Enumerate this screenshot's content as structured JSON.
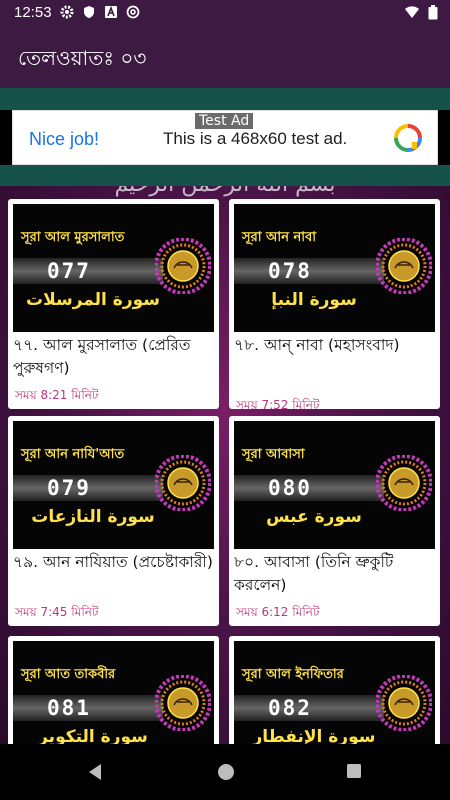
{
  "status_bar": {
    "time": "12:53",
    "icons": [
      "gear-icon",
      "shield-icon",
      "a-badge-icon",
      "at-sign-icon",
      "wifi-icon",
      "battery-icon"
    ]
  },
  "app_bar": {
    "title": "তেলওয়াতঃ ০৩"
  },
  "ad": {
    "label": "Test Ad",
    "nice_job": "Nice job!",
    "text": "This is a 468x60 test ad."
  },
  "content": {
    "arabic_banner": "بسم الله الرحمن الرحيم",
    "cards": [
      {
        "thumb_bengali": "সূরা আল মুরসালাত",
        "thumb_number": "077",
        "thumb_arabic": "سورة المرسلات",
        "title": "৭৭. আল মুরসালাত (প্রেরিত পুরুষগণ)",
        "duration": "সময় 8:21 মিনিট"
      },
      {
        "thumb_bengali": "সূরা আন নাবা",
        "thumb_number": "078",
        "thumb_arabic": "سورة النبإ",
        "title": "৭৮. আন্ নাবা (মহাসংবাদ)",
        "duration": "সময় 7:52 মিনিট"
      },
      {
        "thumb_bengali": "সূরা আন নাযি'আত",
        "thumb_number": "079",
        "thumb_arabic": "سورة النازعات",
        "title": "৭৯. আন নাযিয়াত (প্রচেষ্টাকারী)",
        "duration": "সময় 7:45 মিনিট"
      },
      {
        "thumb_bengali": "সূরা আবাসা",
        "thumb_number": "080",
        "thumb_arabic": "سورة عبس",
        "title": "৮০. আবাসা (তিনি ভ্রুকুটি করলেন)",
        "duration": "সময় 6:12 মিনিট"
      },
      {
        "thumb_bengali": "সূরা আত তাকবীর",
        "thumb_number": "081",
        "thumb_arabic": "سورة التكوير",
        "title": "",
        "duration": ""
      },
      {
        "thumb_bengali": "সূরা আল ইনফিতার",
        "thumb_number": "082",
        "thumb_arabic": "سورة الإنفطار",
        "title": "",
        "duration": ""
      }
    ]
  },
  "colors": {
    "app_bar": "#3d1a42",
    "teal": "#16524a",
    "duration": "#c0357a",
    "thumb_text": "#ffe24a"
  },
  "nav_bar": {
    "icons": [
      "back-icon",
      "home-icon",
      "recent-apps-icon"
    ]
  }
}
